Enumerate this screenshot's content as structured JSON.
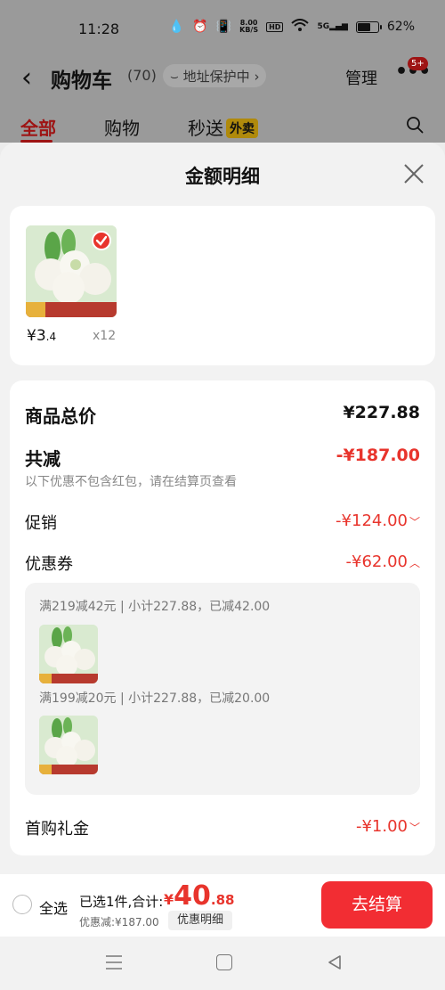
{
  "status_bar": {
    "time": "11:28",
    "speed_top": "8.00",
    "speed_unit": "KB/S",
    "hd": "HD",
    "signal": "5G",
    "battery_percent": "62%",
    "battery_level": 0.62
  },
  "header": {
    "title": "购物车",
    "count": "(70)",
    "address_protect": "地址保护中",
    "manage": "管理",
    "more_badge": "5+"
  },
  "tabs": [
    {
      "label": "全部",
      "active": true
    },
    {
      "label": "购物",
      "active": false
    },
    {
      "label": "秒送",
      "active": false,
      "badge": "外卖"
    }
  ],
  "sheet": {
    "title": "金额明细",
    "item": {
      "price_main": "¥3",
      "price_decimal": ".4",
      "qty": "x12"
    },
    "summary": {
      "total_label": "商品总价",
      "total_value": "¥227.88",
      "reduce_label": "共减",
      "reduce_value": "-¥187.00",
      "note": "以下优惠不包含红包，请在结算页查看",
      "promo_label": "促销",
      "promo_value": "-¥124.00",
      "coupon_label": "优惠券",
      "coupon_value": "-¥62.00",
      "coupons": [
        {
          "text": "满219减42元 | 小计227.88，已减42.00"
        },
        {
          "text": "满199减20元 | 小计227.88，已减20.00"
        }
      ],
      "gift_label": "首购礼金",
      "gift_value": "-¥1.00"
    }
  },
  "bottom_bar": {
    "select_all": "全选",
    "selected_text": "已选1件,合计:",
    "total_yen": "¥",
    "total_int": "40",
    "total_dec": ".88",
    "discount_text": "优惠减:¥187.00",
    "detail_chip": "优惠明细",
    "checkout": "去结算"
  },
  "colors": {
    "accent": "#e8342c",
    "checkout": "#f22d33",
    "overlay_tab": "#9e1414"
  }
}
